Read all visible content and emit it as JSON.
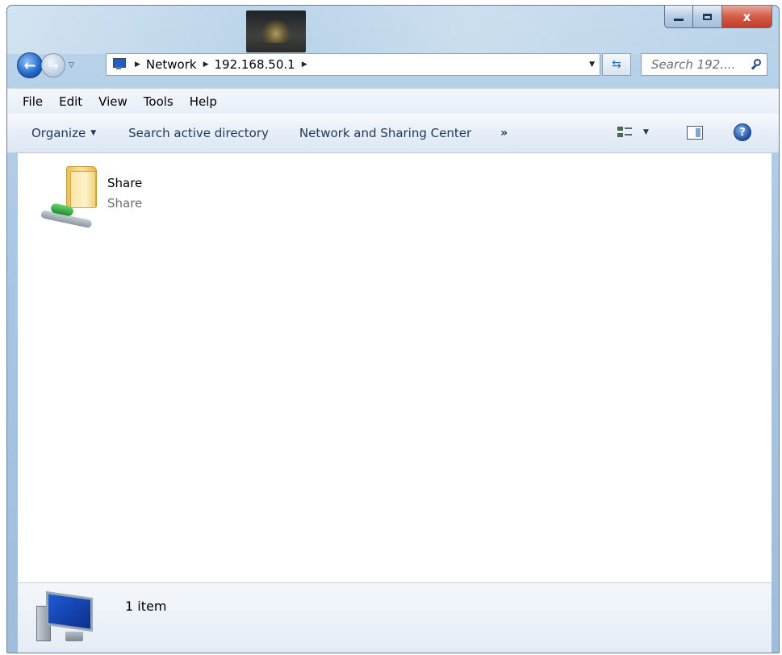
{
  "window": {
    "controls": {
      "minimize": "",
      "maximize": "",
      "close": "x"
    }
  },
  "navigation": {
    "back_icon": "back-arrow-icon",
    "forward_icon": "forward-arrow-icon",
    "address": {
      "crumbs": [
        "Network",
        "192.168.50.1"
      ]
    },
    "search": {
      "placeholder": "Search 192...."
    }
  },
  "menubar": {
    "items": [
      "File",
      "Edit",
      "View",
      "Tools",
      "Help"
    ]
  },
  "commandbar": {
    "organize": "Organize",
    "search_ad": "Search active directory",
    "network_center": "Network and Sharing Center",
    "more": "»"
  },
  "content": {
    "items": [
      {
        "name": "Share",
        "subtitle": "Share",
        "icon": "shared-folder-icon"
      }
    ]
  },
  "status": {
    "count": "1 item",
    "icon": "computer-icon"
  },
  "colors": {
    "frame": "#a9c7e4",
    "close": "#c03d28",
    "accent": "#1f66c7"
  }
}
